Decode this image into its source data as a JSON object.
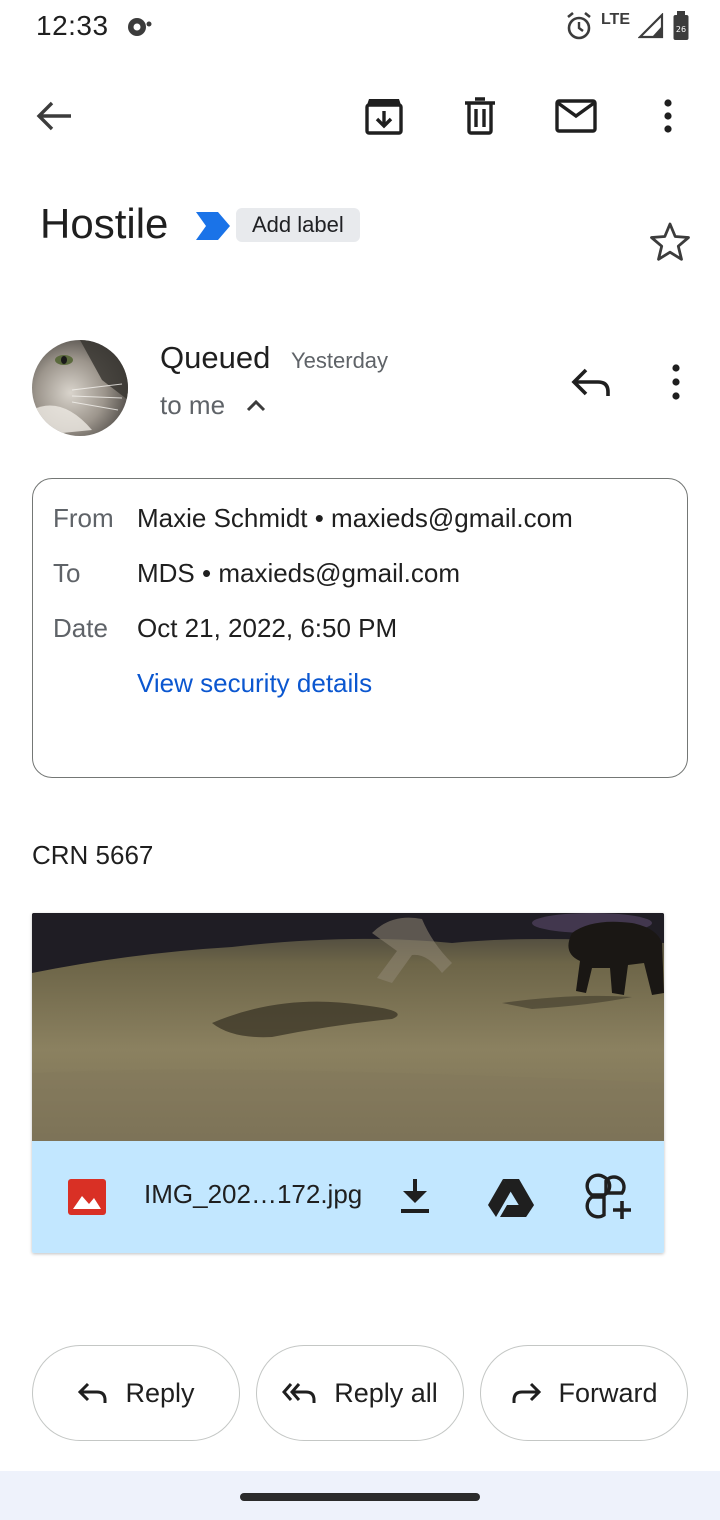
{
  "status_bar": {
    "time": "12:33",
    "network": "LTE",
    "battery": "26"
  },
  "toolbar": {
    "back": "back-arrow-icon",
    "archive": "archive-icon",
    "delete": "delete-icon",
    "mark_unread": "mail-icon",
    "more": "more-vert-icon"
  },
  "subject": {
    "title": "Hostile",
    "add_label": "Add label",
    "accent_color": "#1a73e8"
  },
  "message": {
    "sender": "Queued",
    "time": "Yesterday",
    "recipient_summary": "to me",
    "details": {
      "from_label": "From",
      "from_value": "Maxie Schmidt • maxieds@gmail.com",
      "to_label": "To",
      "to_value": "MDS • maxieds@gmail.com",
      "date_label": "Date",
      "date_value": "Oct 21, 2022, 6:50 PM",
      "security_link": "View security details"
    },
    "body": "CRN 5667",
    "attachment": {
      "filename": "IMG_202…172.jpg"
    }
  },
  "actions": {
    "reply": "Reply",
    "reply_all": "Reply all",
    "forward": "Forward"
  },
  "colors": {
    "link": "#0b57d0",
    "attachment_bar": "#c2e7ff",
    "image_icon": "#d93025"
  }
}
